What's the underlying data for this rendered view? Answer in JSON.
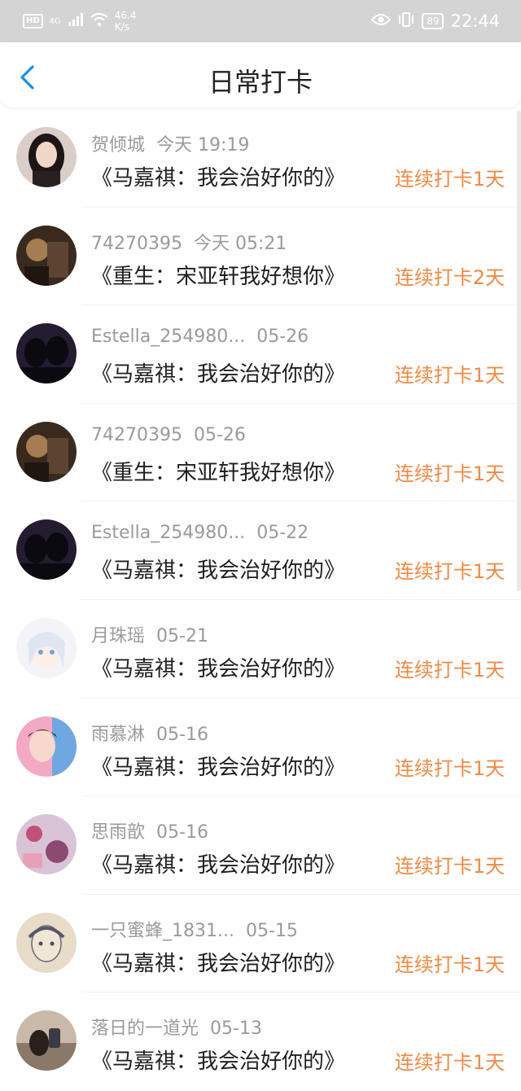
{
  "status_bar": {
    "hd": "HD",
    "network": "4G",
    "speed_value": "46.4",
    "speed_unit": "K/s",
    "battery": "89",
    "time": "22:44"
  },
  "header": {
    "title": "日常打卡"
  },
  "items": [
    {
      "name": "贺倾城",
      "date": "今天 19:19",
      "book": "《马嘉祺：我会治好你的》",
      "streak": "连续打卡1天"
    },
    {
      "name": "74270395",
      "date": "今天 05:21",
      "book": "《重生：宋亚轩我好想你》",
      "streak": "连续打卡2天"
    },
    {
      "name": "Estella_254980...",
      "date": "05-26",
      "book": "《马嘉祺：我会治好你的》",
      "streak": "连续打卡1天"
    },
    {
      "name": "74270395",
      "date": "05-26",
      "book": "《重生：宋亚轩我好想你》",
      "streak": "连续打卡1天"
    },
    {
      "name": "Estella_254980...",
      "date": "05-22",
      "book": "《马嘉祺：我会治好你的》",
      "streak": "连续打卡1天"
    },
    {
      "name": "月珠瑶",
      "date": "05-21",
      "book": "《马嘉祺：我会治好你的》",
      "streak": "连续打卡1天"
    },
    {
      "name": "雨慕淋",
      "date": "05-16",
      "book": "《马嘉祺：我会治好你的》",
      "streak": "连续打卡1天"
    },
    {
      "name": "思雨歆",
      "date": "05-16",
      "book": "《马嘉祺：我会治好你的》",
      "streak": "连续打卡1天"
    },
    {
      "name": "一只蜜蜂_1831...",
      "date": "05-15",
      "book": "《马嘉祺：我会治好你的》",
      "streak": "连续打卡1天"
    },
    {
      "name": "落日的一道光",
      "date": "05-13",
      "book": "《马嘉祺：我会治好你的》",
      "streak": "连续打卡1天"
    }
  ],
  "colors": {
    "accent": "#f08a46",
    "back_arrow": "#1a8fe3"
  }
}
